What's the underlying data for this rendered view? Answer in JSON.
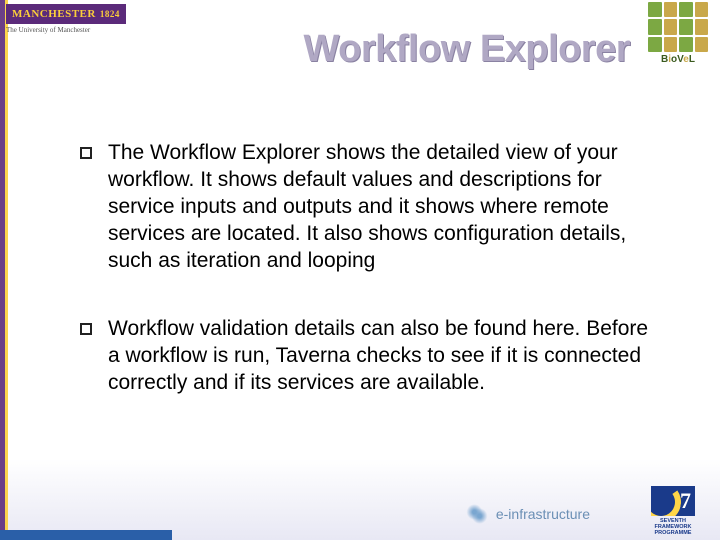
{
  "header": {
    "manchester": {
      "name": "MANCHESTER",
      "year": "1824",
      "subtitle": "The University of Manchester"
    },
    "biovel": {
      "name": "BioVeL"
    },
    "title": "Workflow Explorer"
  },
  "bullets": [
    "The Workflow Explorer shows the detailed view of your workflow. It shows default values and descriptions for service inputs and outputs and it shows where remote services are located. It also shows configuration details, such as iteration and looping",
    "Workflow validation details can also be found here. Before a workflow is run, Taverna checks to see if it is connected correctly and if its services are available."
  ],
  "footer": {
    "einfra": "e-infrastructure",
    "fp7_line1": "SEVENTH FRAMEWORK",
    "fp7_line2": "PROGRAMME"
  }
}
